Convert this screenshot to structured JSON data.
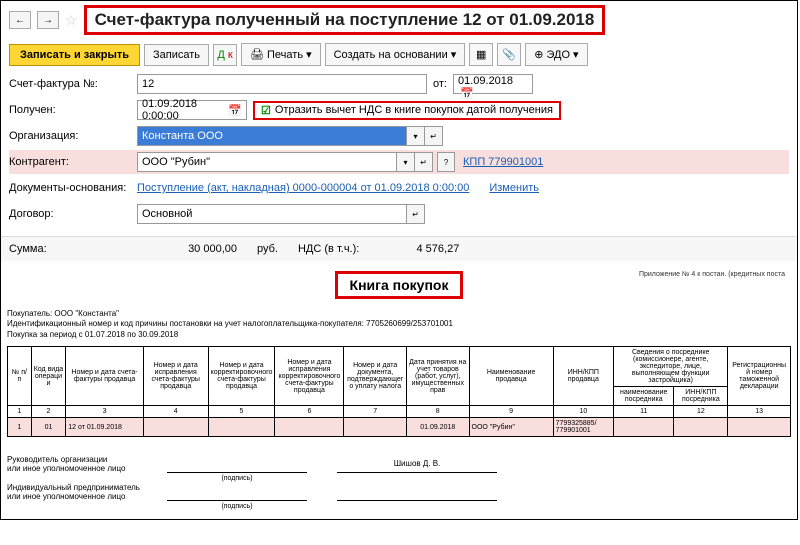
{
  "header": {
    "title": "Счет-фактура полученный на поступление 12 от 01.09.2018"
  },
  "toolbar": {
    "save_close": "Записать и закрыть",
    "save": "Записать",
    "print": "Печать",
    "create_based": "Создать на основании",
    "edo": "ЭДО"
  },
  "form": {
    "invoice_no_label": "Счет-фактура №:",
    "invoice_no": "12",
    "received_label": "Получен:",
    "received": "01.09.2018  0:00:00",
    "ot_label": "от:",
    "ot": "01.09.2018",
    "checkbox_label": "Отразить вычет НДС в книге покупок датой получения",
    "org_label": "Организация:",
    "org": "Константа ООО",
    "contr_label": "Контрагент:",
    "contr": "ООО \"Рубин\"",
    "kpp_link": "КПП 779901001",
    "doc_basis_label": "Документы-основания:",
    "doc_basis_link": "Поступление (акт, накладная) 0000-000004 от 01.09.2018 0:00:00",
    "change_link": "Изменить",
    "contract_label": "Договор:",
    "contract": "Основной",
    "sum_label": "Сумма:",
    "sum_val": "30 000,00",
    "sum_cur": "руб.",
    "vat_label": "НДС (в т.ч.):",
    "vat_val": "4 576,27"
  },
  "book": {
    "appendix": "Приложение № 4 к постан.\n(кредитных поста",
    "title": "Книга покупок",
    "buyer_line": "Покупатель:  ООО \"Константа\"",
    "inn_line": "Идентификационный номер и код причины постановки на учет налогоплательщика-покупателя:  7705260699/253701001",
    "period_line": "Покупка за период с 01.07.2018 по 30.09.2018",
    "headers": {
      "h1": "№ п/п",
      "h2": "Код вида операции",
      "h3": "Номер и дата счета-фактуры продавца",
      "h4": "Номер и дата исправления счета-фактуры продавца",
      "h5": "Номер и дата корректировочного счета-фактуры продавца",
      "h6": "Номер и дата исправления корректировочного счета-фактуры продавца",
      "h7": "Номер и дата документа, подтверждающего уплату налога",
      "h8": "Дата принятия на учет товаров (работ, услуг), имущественных прав",
      "h9": "Наименование продавца",
      "h10": "ИНН/КПП продавца",
      "h11top": "Сведения о посреднике (комиссионере, агенте, экспедиторе, лице, выполняющем функции застройщика)",
      "h11": "наименование посредника",
      "h12": "ИНН/КПП посредника",
      "h13": "Регистрационный номер таможенной декларации"
    },
    "colnums": [
      "1",
      "2",
      "3",
      "4",
      "5",
      "6",
      "7",
      "8",
      "9",
      "10",
      "11",
      "12",
      "13"
    ],
    "row": {
      "c1": "1",
      "c2": "01",
      "c3": "12 от 01.09.2018",
      "c4": "",
      "c5": "",
      "c6": "",
      "c7": "",
      "c8": "01.09.2018",
      "c9": "ООО \"Рубин\"",
      "c10": "7799325885/ 779901001",
      "c11": "",
      "c12": "",
      "c13": ""
    },
    "sig": {
      "head1": "Руководитель организации",
      "head2": "или иное уполномоченное лицо",
      "sign_lbl": "(подпись)",
      "name": "Шишов Д. В.",
      "ip1": "Индивидуальный предприниматель",
      "ip2": "или иное уполномоченное лицо"
    }
  }
}
